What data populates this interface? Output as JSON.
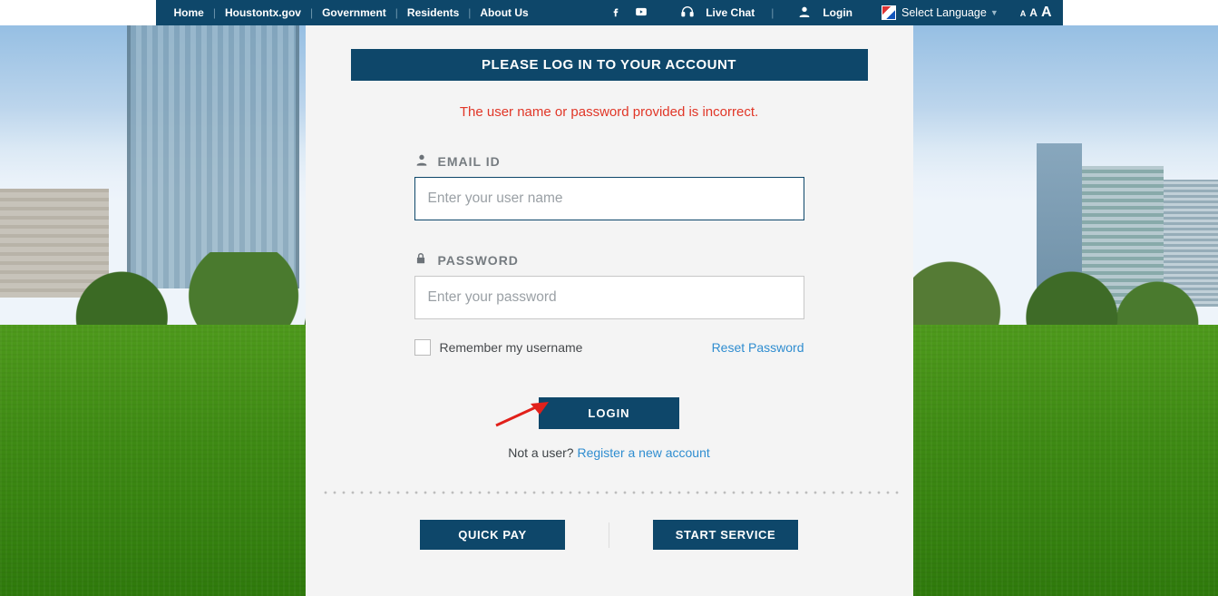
{
  "nav": {
    "home": "Home",
    "houstontx": "Houstontx.gov",
    "government": "Government",
    "residents": "Residents",
    "about": "About Us",
    "livechat": "Live Chat",
    "login": "Login",
    "selectlang": "Select Language"
  },
  "textsize": {
    "sm": "A",
    "md": "A",
    "lg": "A"
  },
  "login": {
    "header": "PLEASE LOG IN TO YOUR ACCOUNT",
    "error": "The user name or password provided is incorrect.",
    "email_label": "EMAIL ID",
    "email_placeholder": "Enter your user name",
    "password_label": "PASSWORD",
    "password_placeholder": "Enter your password",
    "remember": "Remember my username",
    "reset": "Reset Password",
    "button": "LOGIN",
    "notuser": "Not a user? ",
    "register": "Register a new account"
  },
  "footer": {
    "quickpay": "QUICK PAY",
    "startservice": "START SERVICE"
  }
}
